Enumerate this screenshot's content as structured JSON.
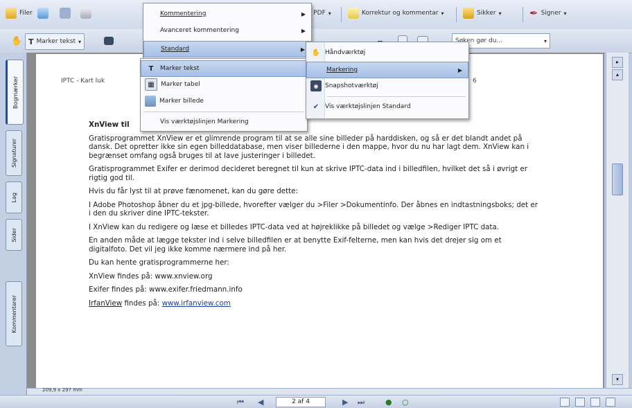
{
  "toolbar1": {
    "file_label": "Filer",
    "create_label": "Opret PDF",
    "comment_label": "Korrektur og kommentar",
    "secure_label": "Sikker",
    "sign_label": "Signer"
  },
  "toolbar2": {
    "select_text_label": "Marker tekst",
    "search_placeholder": "Søken gør du..."
  },
  "left_tabs": [
    "Bogmærker",
    "Signaturer",
    "Lag",
    "Sider",
    "Kommentarer"
  ],
  "menu_main": {
    "items": [
      {
        "label": "Kommentering",
        "arrow": "▶"
      },
      {
        "label": "Avanceret kommentering",
        "arrow": "▶"
      },
      {
        "label": "Standard",
        "arrow": "▶"
      }
    ]
  },
  "menu_select": {
    "items": [
      {
        "label": "Marker tekst"
      },
      {
        "label": "Marker tabel"
      },
      {
        "label": "Marker billede"
      },
      {
        "label": "Vis værktøjslinjen Markering"
      }
    ]
  },
  "menu_standard": {
    "items": [
      {
        "label": "Håndværktøj"
      },
      {
        "label": "Markering",
        "arrow": "▶"
      },
      {
        "label": "Snapshotværktøj"
      },
      {
        "label": "Vis værktøjslinjen Standard",
        "checked": "✔"
      }
    ]
  },
  "document": {
    "header_line": "IPTC - Kart luk",
    "header_tail": "6",
    "heading": "XnView til",
    "paragraphs": [
      "Gratisprogrammet XnView er et glimrende program til at se alle sine billeder på harddisken, og så er det blandt andet på dansk. Det opretter ikke sin egen billeddatabase, men viser billederne i den mappe, hvor du nu har lagt dem. XnView kan i begrænset omfang også bruges til at lave justeringer i billedet.",
      "Gratisprogrammet Exifer er derimod decideret beregnet til kun at skrive IPTC-data ind i billedfilen, hvilket det så i øvrigt er rigtig god til.",
      "Hvis du får lyst til at prøve fænomenet, kan du gøre dette:",
      "I Adobe Photoshop åbner du et jpg-billede, hvorefter vælger du >Filer >Dokumentinfo. Der åbnes en indtastningsboks; det er i den du skriver dine IPTC-tekster.",
      "I XnView kan du redigere og læse et billedes IPTC-data ved at højreklikke på billedet og vælge >Rediger IPTC data.",
      "En anden måde at lægge tekster ind i selve billedfilen er at benytte Exif-felterne, men kan hvis det drejer sig om et digitalfoto. Det vil jeg ikke komme nærmere ind på her.",
      "Du kan hente gratisprogrammerne her:",
      "XnView findes på: www.xnview.org",
      "Exifer findes på: www.exifer.friedmann.info"
    ],
    "irfan_prefix": "IrfanView",
    "irfan_middle": " findes på: ",
    "irfan_link": "www.irfanview.com"
  },
  "status": {
    "page_size": "209,9 x 297 mm",
    "page_indicator": "2 af 4"
  },
  "colors": {
    "menu_highlight": "#a8c0e6",
    "toolbar": "#cfd9ea",
    "link": "#1a3fa8"
  }
}
